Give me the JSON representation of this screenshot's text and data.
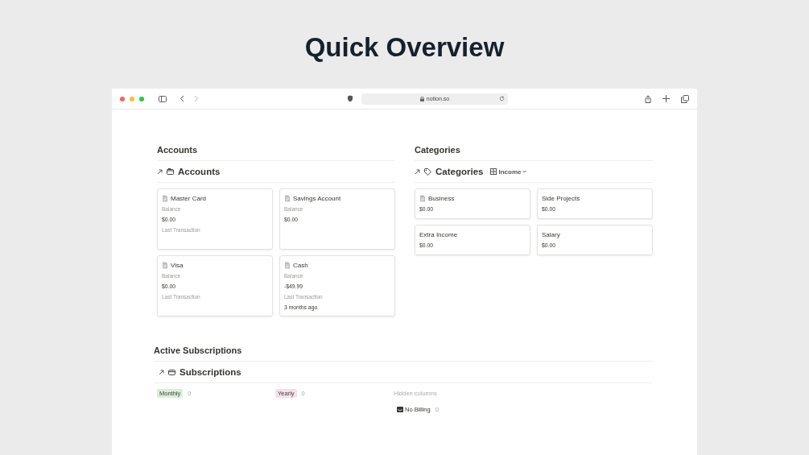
{
  "title": "Quick Overview",
  "browser": {
    "url": "notion.so"
  },
  "accounts": {
    "heading": "Accounts",
    "database": "Accounts",
    "cards": [
      {
        "name": "Master Card",
        "fields": [
          {
            "label": "Balance",
            "value": "$0.00"
          },
          {
            "label": "Last Transaction"
          }
        ]
      },
      {
        "name": "Savings Account",
        "fields": [
          {
            "label": "Balance",
            "value": "$0.00"
          }
        ]
      },
      {
        "name": "Visa",
        "fields": [
          {
            "label": "Balance",
            "value": "$0.00"
          },
          {
            "label": "Last Transaction"
          }
        ]
      },
      {
        "name": "Cash",
        "fields": [
          {
            "label": "Balance",
            "value": "-$49.99"
          },
          {
            "label": "Last Transaction",
            "value": "3 months ago"
          }
        ]
      }
    ]
  },
  "categories": {
    "heading": "Categories",
    "database": "Categories",
    "view": "Income",
    "cards": [
      {
        "name": "Business",
        "page_icon": true,
        "value": "$0.00"
      },
      {
        "name": "Side Projects",
        "page_icon": false,
        "value": "$0.00"
      },
      {
        "name": "Extra Income",
        "page_icon": false,
        "value": "$0.00"
      },
      {
        "name": "Salary",
        "page_icon": false,
        "value": "$0.00"
      }
    ]
  },
  "subscriptions": {
    "heading": "Active Subscriptions",
    "database": "Subscriptions",
    "groups": [
      {
        "label": "Monthly",
        "count": "0",
        "color": "#dbeddb"
      },
      {
        "label": "Yearly",
        "count": "0",
        "color": "#f5e0e9"
      }
    ],
    "hidden_label": "Hidden columns",
    "hidden": [
      {
        "label": "No Billing",
        "count": "0"
      }
    ]
  }
}
